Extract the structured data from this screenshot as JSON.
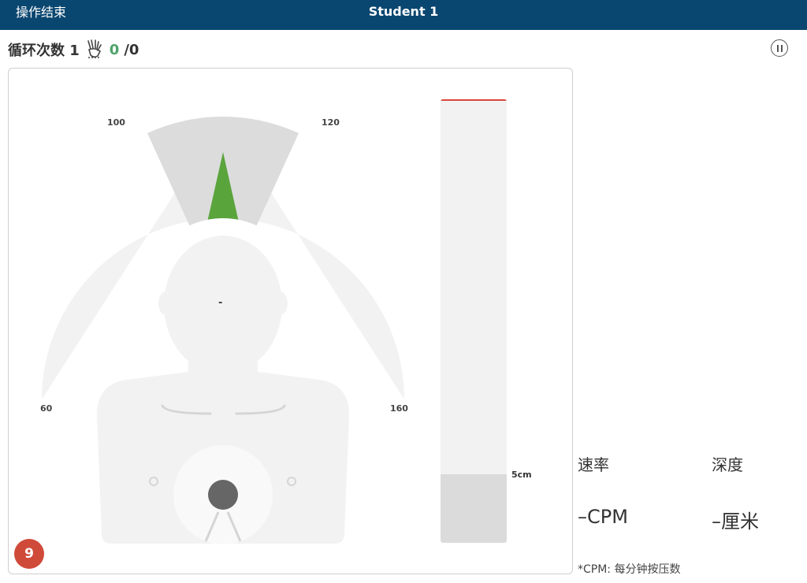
{
  "header": {
    "end_label": "操作结束",
    "title": "Student 1"
  },
  "cycle": {
    "label": "循环次数 1",
    "done": "0",
    "total": "/0"
  },
  "gauge": {
    "tick_labels": [
      "100",
      "120",
      "60",
      "160"
    ],
    "center_value": "-",
    "target_range_cpm": [
      100,
      120
    ],
    "needle_color": "#5aa43c"
  },
  "depth": {
    "target_label": "5cm",
    "fill_fraction": 0.155
  },
  "badge": {
    "value": "9",
    "color": "#d04a3a"
  },
  "stats": {
    "rate_label": "速率",
    "depth_label": "深度",
    "rate_value": "–CPM",
    "depth_value": "–厘米"
  },
  "footnote": "*CPM: 每分钟按压数",
  "colors": {
    "header_bg": "#0a4770",
    "accent_green": "#4ea36a"
  }
}
